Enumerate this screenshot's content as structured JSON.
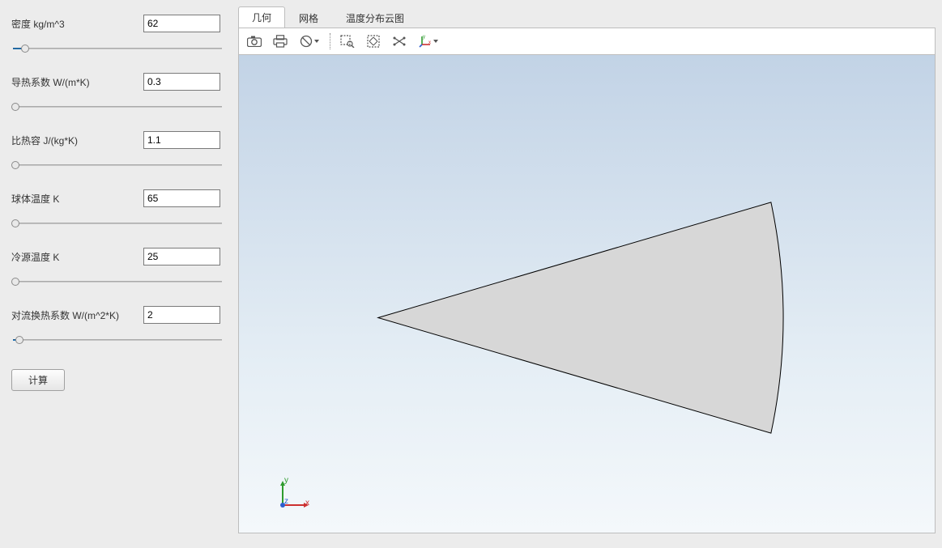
{
  "params": [
    {
      "label": "密度 kg/m^3",
      "value": "62",
      "slider_pct": 6
    },
    {
      "label": "导热系数 W/(m*K)",
      "value": "0.3",
      "slider_pct": 1
    },
    {
      "label": "比热容 J/(kg*K)",
      "value": "1.1",
      "slider_pct": 1
    },
    {
      "label": "球体温度 K",
      "value": "65",
      "slider_pct": 1
    },
    {
      "label": "冷源温度 K",
      "value": "25",
      "slider_pct": 1
    },
    {
      "label": "对流换热系数 W/(m^2*K)",
      "value": "2",
      "slider_pct": 3
    }
  ],
  "compute_label": "计算",
  "tabs": [
    {
      "label": "几何",
      "active": true
    },
    {
      "label": "网格",
      "active": false
    },
    {
      "label": "温度分布云图",
      "active": false
    }
  ],
  "toolbar_icons": [
    "camera-icon",
    "print-icon",
    "reset-view-icon",
    "sep",
    "zoom-box-icon",
    "fit-view-icon",
    "rotate-icon",
    "axis-icon"
  ],
  "axis": {
    "x": "x",
    "y": "y",
    "z": "z"
  }
}
